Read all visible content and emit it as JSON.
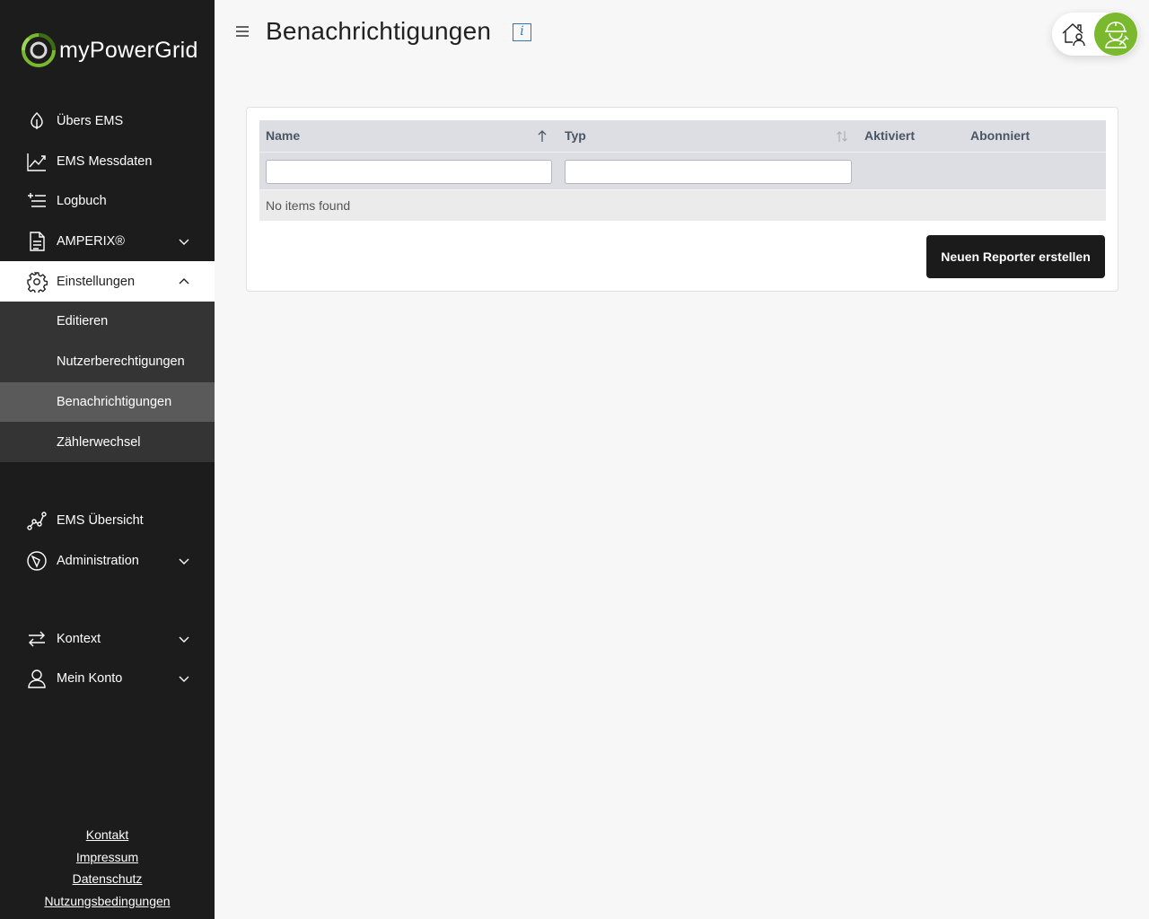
{
  "brand": {
    "name": "myPowerGrid",
    "accent": "#7ab82e"
  },
  "sidebar": {
    "items": [
      {
        "label": "Übers EMS",
        "icon": "leaf-icon"
      },
      {
        "label": "EMS Messdaten",
        "icon": "line-chart-icon"
      },
      {
        "label": "Logbuch",
        "icon": "list-add-icon"
      },
      {
        "label": "AMPERIX®",
        "icon": "document-icon"
      },
      {
        "label": "Einstellungen",
        "icon": "gear-icon"
      },
      {
        "label": "EMS Übersicht",
        "icon": "network-icon"
      },
      {
        "label": "Administration",
        "icon": "compass-icon"
      },
      {
        "label": "Kontext",
        "icon": "swap-arrows-icon"
      },
      {
        "label": "Mein Konto",
        "icon": "user-icon"
      }
    ],
    "settings_submenu": [
      {
        "label": "Editieren"
      },
      {
        "label": "Nutzerberechtigungen"
      },
      {
        "label": "Benachrichtigungen"
      },
      {
        "label": "Zählerwechsel"
      }
    ],
    "footer_links": [
      "Kontakt",
      "Impressum",
      "Datenschutz",
      "Nutzungsbedingungen"
    ]
  },
  "header": {
    "title": "Benachrichtigungen",
    "info_symbol": "i"
  },
  "table": {
    "columns": [
      "Name",
      "Typ",
      "Aktiviert",
      "Abonniert"
    ],
    "filter_values": {
      "name": "",
      "typ": ""
    },
    "empty_message": "No items found"
  },
  "actions": {
    "create_reporter": "Neuen Reporter erstellen"
  }
}
